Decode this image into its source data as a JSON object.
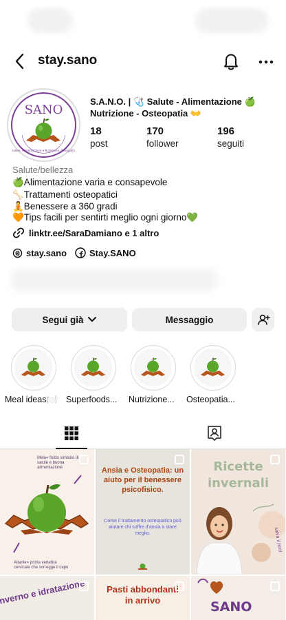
{
  "header": {
    "username": "stay.sano"
  },
  "profile": {
    "logo_text": "SANO",
    "logo_ring_text": "Salute, Alimentazione e Nutrizione, Osteopatia",
    "full_name_line1": "S.A.N.O. | 🩺 Salute - Alimentazione 🍏",
    "full_name_line2": "Nutrizione - Osteopatia 👐",
    "stats": [
      {
        "value": "18",
        "label": "post"
      },
      {
        "value": "170",
        "label": "follower"
      },
      {
        "value": "196",
        "label": "seguiti"
      }
    ],
    "category": "Salute/bellezza",
    "bio": [
      "🍏Alimentazione varia e consapevole",
      "🦴Trattamenti osteopatici",
      "🧘Benessere a 360 gradi",
      "🧡Tips facili per sentirti meglio ogni giorno💚"
    ],
    "link_text": "linktr.ee/SaraDamiano e 1 altro",
    "threads_handle": "stay.sano",
    "facebook_handle": "Stay.SANO"
  },
  "actions": {
    "follow_label": "Segui già",
    "message_label": "Messaggio"
  },
  "highlights": [
    {
      "label": "Meal ideas🍽️"
    },
    {
      "label": "Superfoods..."
    },
    {
      "label": "Nutrizione..."
    },
    {
      "label": "Osteopatia..."
    }
  ],
  "posts": {
    "p1_top_text": "Mela= frutto simbolo di salute e buona alimentazione",
    "p1_bottom_text": "Atlante= prima vertebra cervicale che sorregge il capo",
    "p2_title": "Ansia e Osteopatia: un aiuto per il benessere psicofisico.",
    "p2_sub": "Come il trattamento osteopatico può aiutare chi soffre d'ansia a stare meglio.",
    "p3_title": "Ricette invernali",
    "p3_side": "salva il post",
    "p4_title": "Inverno e idratazione",
    "p5_title": "Pasti abbondanti in arrivo",
    "p6_title": "SANO"
  },
  "colors": {
    "accent_purple": "#7b3f98",
    "apple_green": "#5aa62a",
    "atlas_brown": "#b5551c",
    "button_gray": "#efefef"
  },
  "icons": {
    "back": "chevron-left-icon",
    "bell": "bell-icon",
    "more": "more-horizontal-icon",
    "link": "link-icon",
    "threads": "threads-icon",
    "facebook": "facebook-icon",
    "add_person": "add-person-icon",
    "grid": "grid-icon",
    "tagged": "tagged-person-icon"
  }
}
